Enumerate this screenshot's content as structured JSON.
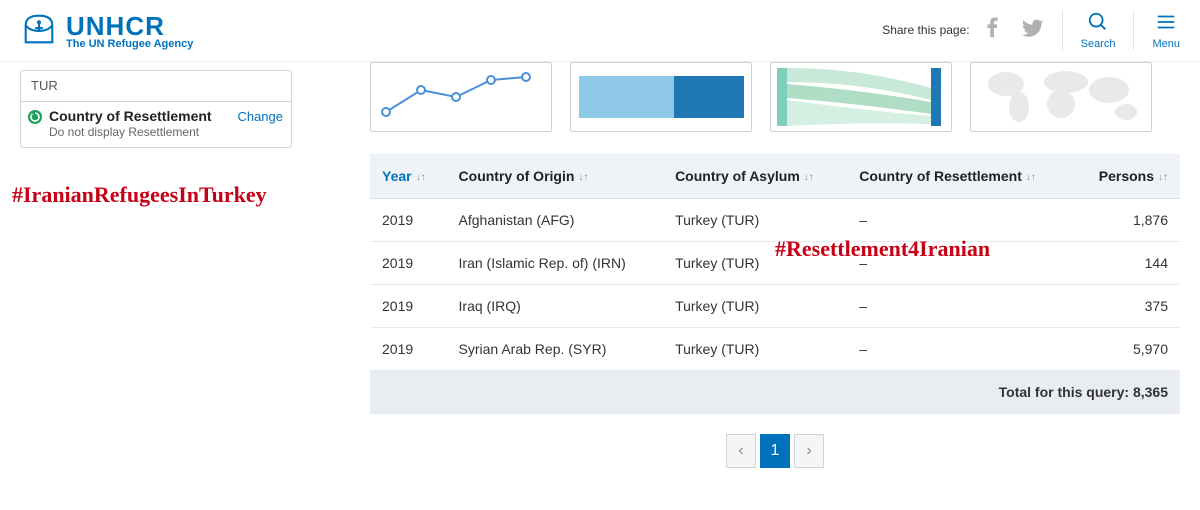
{
  "header": {
    "logo_main": "UNHCR",
    "logo_sub": "The UN Refugee Agency",
    "share_label": "Share this page:",
    "search_label": "Search",
    "menu_label": "Menu"
  },
  "sidebar": {
    "tag": "TUR",
    "facet_title": "Country of Resettlement",
    "facet_change": "Change",
    "facet_sub": "Do not display Resettlement"
  },
  "table": {
    "headers": {
      "year": "Year",
      "origin": "Country of Origin",
      "asylum": "Country of Asylum",
      "resettlement": "Country of Resettlement",
      "persons": "Persons"
    },
    "rows": [
      {
        "year": "2019",
        "origin": "Afghanistan (AFG)",
        "asylum": "Turkey (TUR)",
        "resettlement": "–",
        "persons": "1,876"
      },
      {
        "year": "2019",
        "origin": "Iran (Islamic Rep. of) (IRN)",
        "asylum": "Turkey (TUR)",
        "resettlement": "–",
        "persons": "144"
      },
      {
        "year": "2019",
        "origin": "Iraq (IRQ)",
        "asylum": "Turkey (TUR)",
        "resettlement": "–",
        "persons": "375"
      },
      {
        "year": "2019",
        "origin": "Syrian Arab Rep. (SYR)",
        "asylum": "Turkey (TUR)",
        "resettlement": "–",
        "persons": "5,970"
      }
    ],
    "total_label": "Total for this query:",
    "total_value": "8,365"
  },
  "pager": {
    "prev": "‹",
    "current": "1",
    "next": "›"
  },
  "overlay": {
    "hashtag1": "#IranianRefugeesInTurkey",
    "hashtag2": "#Resettlement4Iranian"
  },
  "chart_data": [
    {
      "type": "line",
      "x": [
        1,
        2,
        3,
        4,
        5
      ],
      "y": [
        10,
        20,
        18,
        28,
        30
      ]
    },
    {
      "type": "bar-stacked",
      "segments": [
        {
          "color": "#8ec9e8",
          "value": 55
        },
        {
          "color": "#1f78b4",
          "value": 45
        }
      ]
    },
    {
      "type": "sankey-thumb"
    },
    {
      "type": "map-thumb"
    }
  ]
}
